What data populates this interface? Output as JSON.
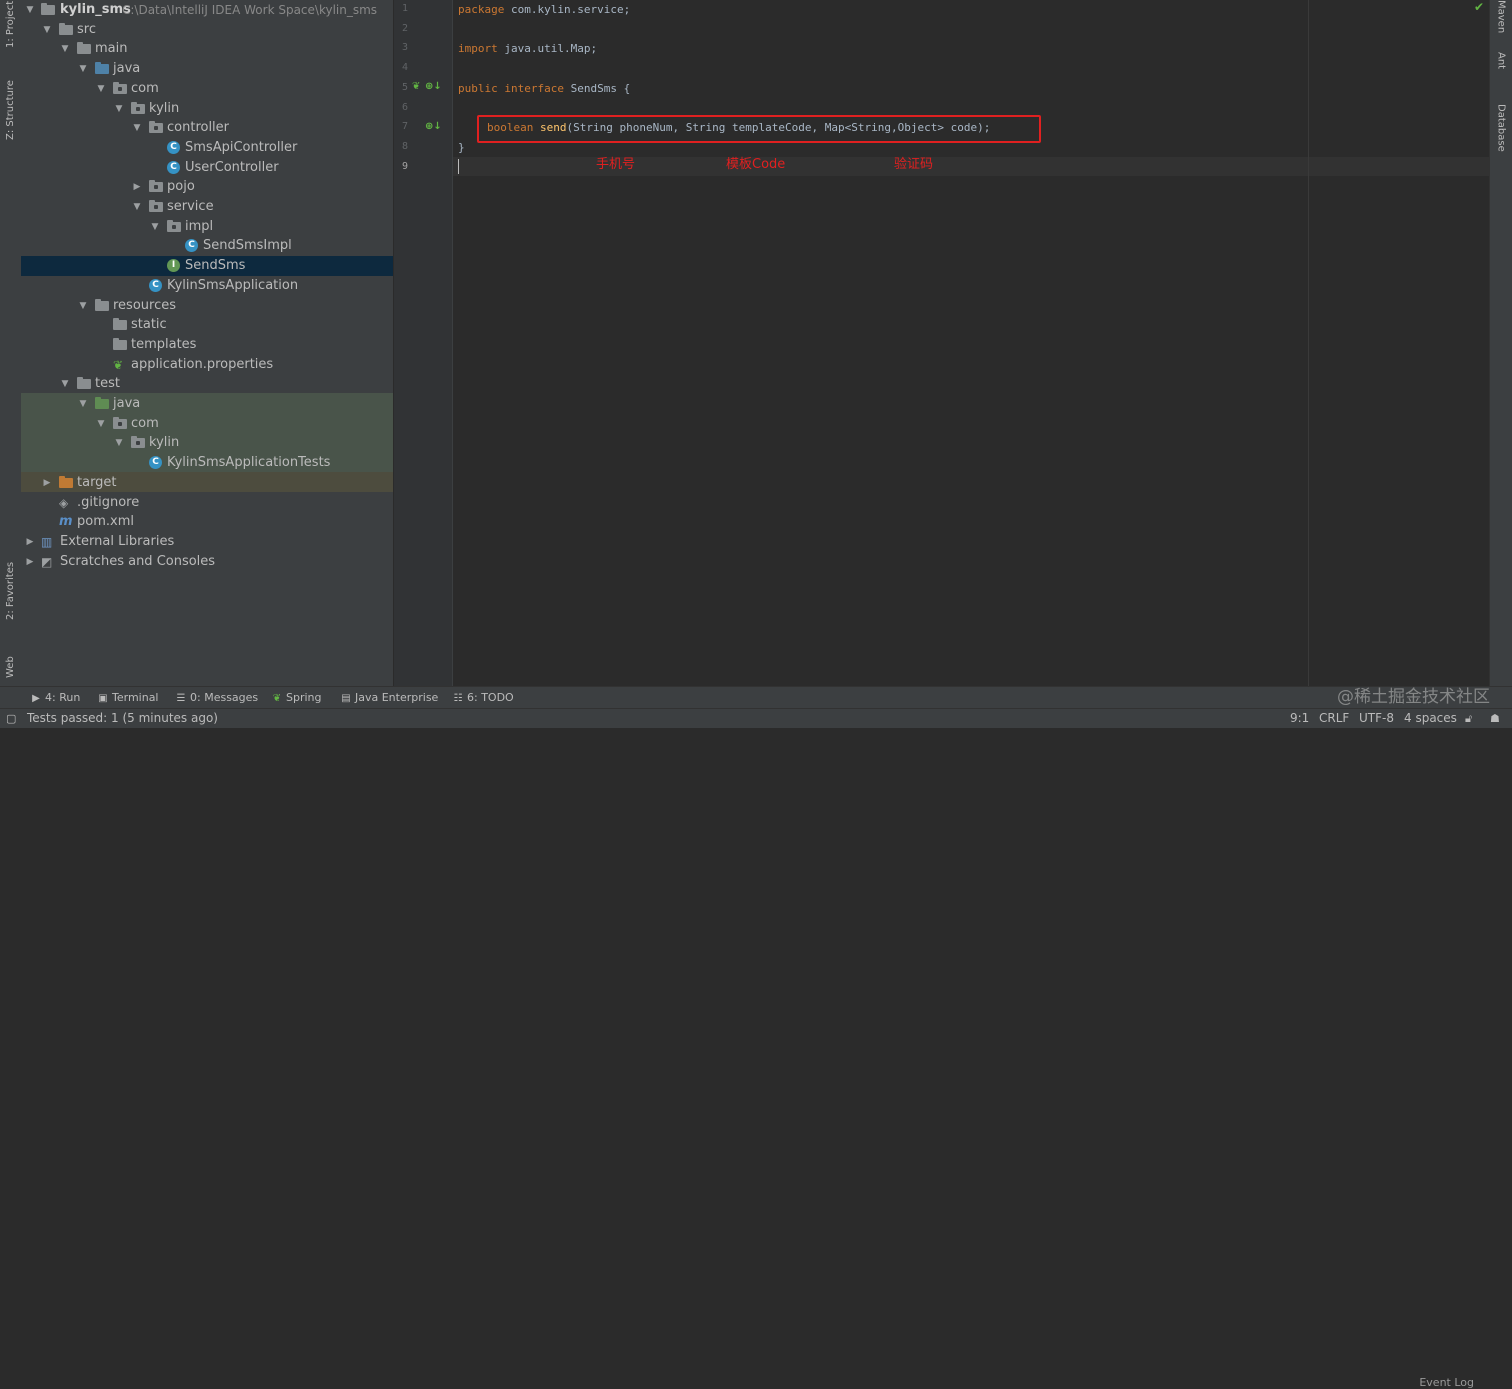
{
  "left_tabs": {
    "project": "1: Project",
    "structure": "Z: Structure",
    "favorites": "2: Favorites",
    "web": "Web"
  },
  "right_tabs": {
    "maven": "Maven",
    "ant": "Ant",
    "database": "Database"
  },
  "tree": {
    "root": {
      "name": "kylin_sms",
      "path": "C:\\Data\\IntelliJ IDEA Work Space\\kylin_sms"
    },
    "items": [
      {
        "label": "src"
      },
      {
        "label": "main"
      },
      {
        "label": "java"
      },
      {
        "label": "com"
      },
      {
        "label": "kylin"
      },
      {
        "label": "controller"
      },
      {
        "label": "SmsApiController"
      },
      {
        "label": "UserController"
      },
      {
        "label": "pojo"
      },
      {
        "label": "service"
      },
      {
        "label": "impl"
      },
      {
        "label": "SendSmsImpl"
      },
      {
        "label": "SendSms"
      },
      {
        "label": "KylinSmsApplication"
      },
      {
        "label": "resources"
      },
      {
        "label": "static"
      },
      {
        "label": "templates"
      },
      {
        "label": "application.properties"
      },
      {
        "label": "test"
      },
      {
        "label": "java"
      },
      {
        "label": "com"
      },
      {
        "label": "kylin"
      },
      {
        "label": "KylinSmsApplicationTests"
      },
      {
        "label": "target"
      },
      {
        "label": ".gitignore"
      },
      {
        "label": "pom.xml"
      },
      {
        "label": "External Libraries"
      },
      {
        "label": "Scratches and Consoles"
      }
    ]
  },
  "editor": {
    "line_numbers": [
      "1",
      "2",
      "3",
      "4",
      "5",
      "6",
      "7",
      "8",
      "9"
    ],
    "code": {
      "l1_kw": "package",
      "l1_rest": " com.kylin.service;",
      "l3_kw": "import",
      "l3_rest": " java.util.Map;",
      "l5_kw1": "public",
      "l5_kw2": "interface",
      "l5_rest": " SendSms {",
      "l7_kw": "boolean",
      "l7_fn": "send",
      "l7_rest": "(String phoneNum, String templateCode, Map<String,Object> code);",
      "l8": "}"
    },
    "annotations": {
      "phone": "手机号",
      "template": "模板Code",
      "code": "验证码"
    },
    "highlight_color": "#e02020"
  },
  "bottom_tabs": [
    {
      "icon": "run-icon",
      "label": "4: Run"
    },
    {
      "icon": "terminal-icon",
      "label": "Terminal"
    },
    {
      "icon": "messages-icon",
      "label": "0: Messages"
    },
    {
      "icon": "spring-icon",
      "label": "Spring"
    },
    {
      "icon": "java-enterprise-icon",
      "label": "Java Enterprise"
    },
    {
      "icon": "todo-icon",
      "label": "6: TODO"
    }
  ],
  "event_log": "Event Log",
  "status": {
    "message": "Tests passed: 1 (5 minutes ago)",
    "position": "9:1",
    "line_sep": "CRLF",
    "encoding": "UTF-8",
    "indent": "4 spaces"
  },
  "watermark": "@稀土掘金技术社区"
}
